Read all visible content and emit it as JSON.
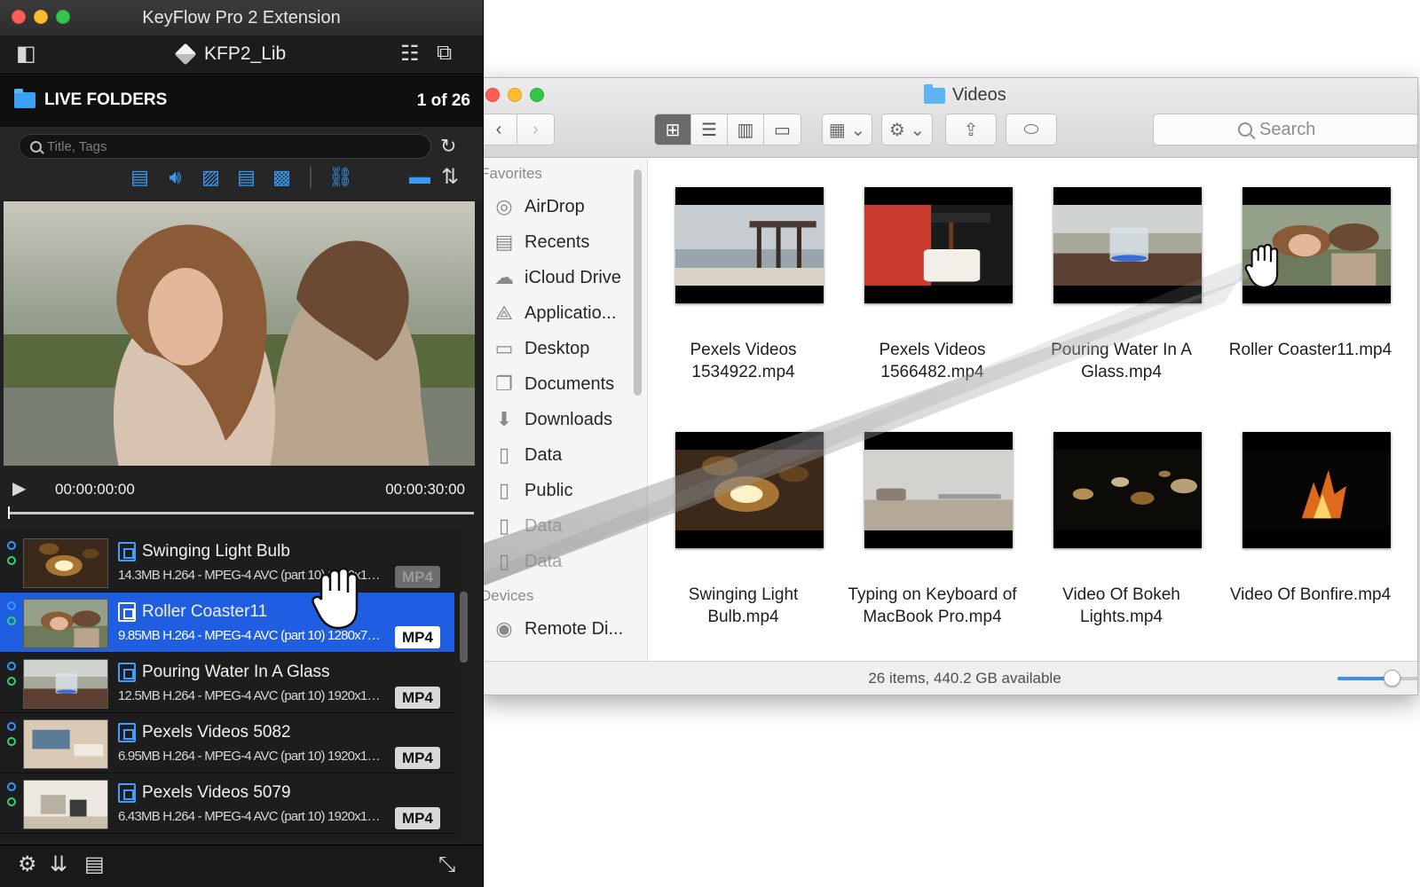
{
  "finder": {
    "title": "Videos",
    "search_placeholder": "Search",
    "sidebar": {
      "favorites_heading": "Favorites",
      "items": [
        {
          "label": "AirDrop",
          "icon": "airdrop-icon",
          "dim": false
        },
        {
          "label": "Recents",
          "icon": "recents-icon",
          "dim": false
        },
        {
          "label": "iCloud Drive",
          "icon": "icloud-icon",
          "dim": false
        },
        {
          "label": "Applicatio...",
          "icon": "applications-icon",
          "dim": false
        },
        {
          "label": "Desktop",
          "icon": "desktop-icon",
          "dim": false
        },
        {
          "label": "Documents",
          "icon": "documents-icon",
          "dim": false
        },
        {
          "label": "Downloads",
          "icon": "downloads-icon",
          "dim": false
        },
        {
          "label": "Data",
          "icon": "file-icon",
          "dim": false
        },
        {
          "label": "Public",
          "icon": "file-icon",
          "dim": false
        },
        {
          "label": "Data",
          "icon": "file-icon",
          "dim": true
        },
        {
          "label": "Data",
          "icon": "file-icon",
          "dim": true
        }
      ],
      "devices_heading": "Devices",
      "device_items": [
        {
          "label": "Remote Di...",
          "icon": "disc-icon"
        }
      ]
    },
    "files": [
      {
        "name": "Pexels Videos 1534922.mp4",
        "line1": "Pexels Videos",
        "line2": "1534922.mp4",
        "thumb": "pier"
      },
      {
        "name": "Pexels Videos 1566482.mp4",
        "line1": "Pexels Videos",
        "line2": "1566482.mp4",
        "thumb": "coffee"
      },
      {
        "name": "Pouring Water In A Glass.mp4",
        "line1": "Pouring Water In A",
        "line2": "Glass.mp4",
        "thumb": "glass"
      },
      {
        "name": "Roller Coaster11.mp4",
        "line1": "Roller Coaster11.mp4",
        "line2": "",
        "thumb": "women"
      },
      {
        "name": "Swinging Light Bulb.mp4",
        "line1": "Swinging Light",
        "line2": "Bulb.mp4",
        "thumb": "bulb"
      },
      {
        "name": "Typing on Keyboard of MacBook Pro.mp4",
        "line1": "Typing on Keyboard of",
        "line2": "MacBook Pro.mp4",
        "thumb": "laptop"
      },
      {
        "name": "Video Of Bokeh Lights.mp4",
        "line1": "Video Of Bokeh",
        "line2": "Lights.mp4",
        "thumb": "bokeh"
      },
      {
        "name": "Video Of Bonfire.mp4",
        "line1": "Video Of Bonfire.mp4",
        "line2": "",
        "thumb": "fire"
      }
    ],
    "status": "26 items, 440.2 GB available",
    "icon_size_level": 0.55
  },
  "keyflow": {
    "window_title": "KeyFlow Pro 2 Extension",
    "library_name": "KFP2_Lib",
    "section_title": "LIVE FOLDERS",
    "position": "1 of 26",
    "search_placeholder": "Title, Tags",
    "type_filters": [
      "video-filter-icon",
      "audio-filter-icon",
      "image-filter-icon",
      "document-filter-icon",
      "pattern-filter-icon",
      "hierarchy-icon"
    ],
    "time_current": "00:00:00:00",
    "time_total": "00:00:30:00",
    "playback_progress": 0,
    "clips": [
      {
        "title": "Swinging Light Bulb",
        "meta": "14.3MB H.264 - MPEG-4 AVC (part 10) 1920x108...",
        "format": "MP4",
        "thumb": "bulb",
        "selected": false,
        "faded_badge": true
      },
      {
        "title": "Roller Coaster11",
        "meta": "9.85MB H.264 - MPEG-4 AVC (part 10) 1280x720...",
        "format": "MP4",
        "thumb": "women",
        "selected": true,
        "faded_badge": false
      },
      {
        "title": "Pouring Water In A Glass",
        "meta": "12.5MB H.264 - MPEG-4 AVC (part 10) 1920x108...",
        "format": "MP4",
        "thumb": "glass",
        "selected": false,
        "faded_badge": false
      },
      {
        "title": "Pexels Videos 5082",
        "meta": "6.95MB H.264 - MPEG-4 AVC (part 10) 1920x108...",
        "format": "MP4",
        "thumb": "desk",
        "selected": false,
        "faded_badge": false
      },
      {
        "title": "Pexels Videos 5079",
        "meta": "6.43MB H.264 - MPEG-4 AVC (part 10) 1920x108...",
        "format": "MP4",
        "thumb": "room",
        "selected": false,
        "faded_badge": false
      }
    ]
  },
  "colors": {
    "accent": "#1f5ee0",
    "icon_blue": "#3a9af4",
    "folder_blue": "#5db4f3"
  }
}
